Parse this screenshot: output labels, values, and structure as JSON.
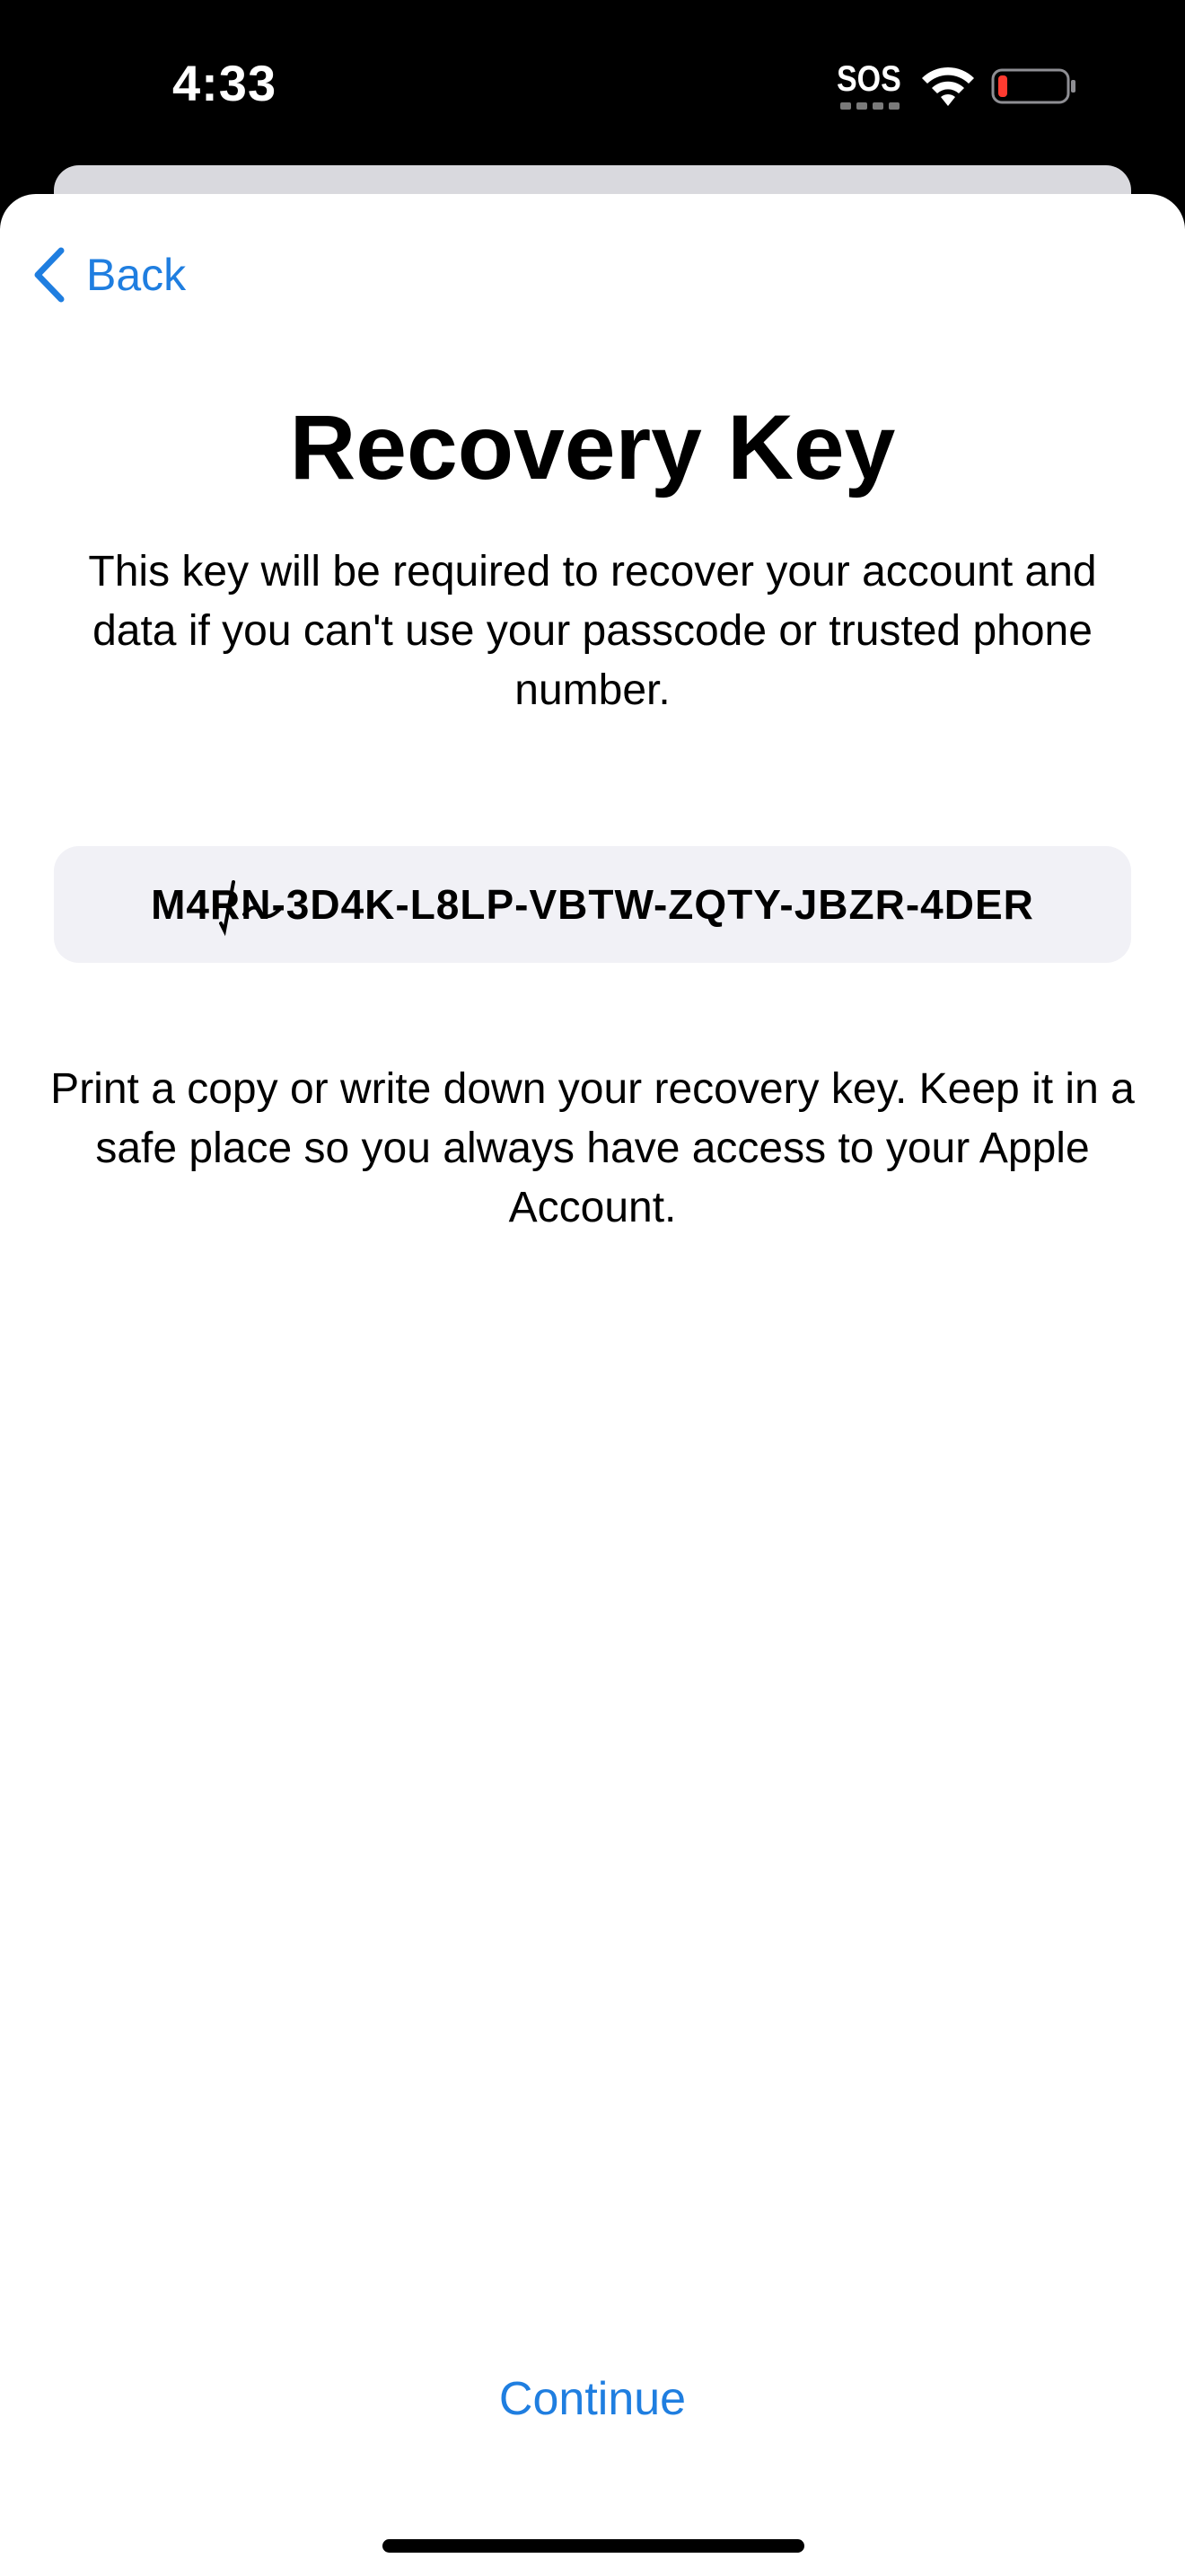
{
  "status_bar": {
    "time": "4:33",
    "sos": "SOS"
  },
  "nav": {
    "back_label": "Back"
  },
  "content": {
    "title": "Recovery Key",
    "description": "This key will be required to recover your account and data if you can't use your passcode or trusted phone number.",
    "recovery_key": "M4RN-3D4K-L8LP-VBTW-ZQTY-JBZR-4DER",
    "instructions": "Print a copy or write down your recovery key. Keep it in a safe place so you always have access to your Apple Account."
  },
  "footer": {
    "continue_label": "Continue"
  },
  "colors": {
    "accent": "#1f7ee0",
    "battery_low": "#ff3b30",
    "key_box_bg": "#f1f1f6"
  }
}
